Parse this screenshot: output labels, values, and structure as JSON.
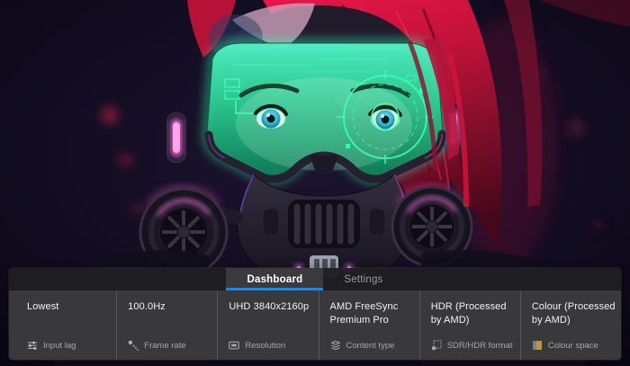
{
  "panel": {
    "accent_color": "#2484d8",
    "tabs": [
      {
        "label": "Dashboard",
        "active": true
      },
      {
        "label": "Settings",
        "active": false
      }
    ],
    "cells": [
      {
        "value": "Lowest",
        "label": "Input lag",
        "icon": "input-lag-icon"
      },
      {
        "value": "100.0Hz",
        "label": "Frame rate",
        "icon": "frame-rate-icon"
      },
      {
        "value": "UHD 3840x2160p",
        "label": "Resolution",
        "icon": "resolution-icon"
      },
      {
        "value": "AMD FreeSync Premium Pro",
        "label": "Content type",
        "icon": "content-type-icon"
      },
      {
        "value": "HDR (Processed by AMD)",
        "label": "SDR/HDR format",
        "icon": "sdr-hdr-format-icon"
      },
      {
        "value": "Colour (Processed by AMD)",
        "label": "Colour space",
        "icon": "colour-space-icon"
      }
    ]
  },
  "artwork": {
    "palette": {
      "background": "#0d0a1a",
      "neon_green": "#35ffb0",
      "neon_magenta": "#ff5fd6",
      "hair_red": "#c01238",
      "panel_background": "#3a3a3c",
      "tabbar_background": "#1f1f21"
    }
  }
}
